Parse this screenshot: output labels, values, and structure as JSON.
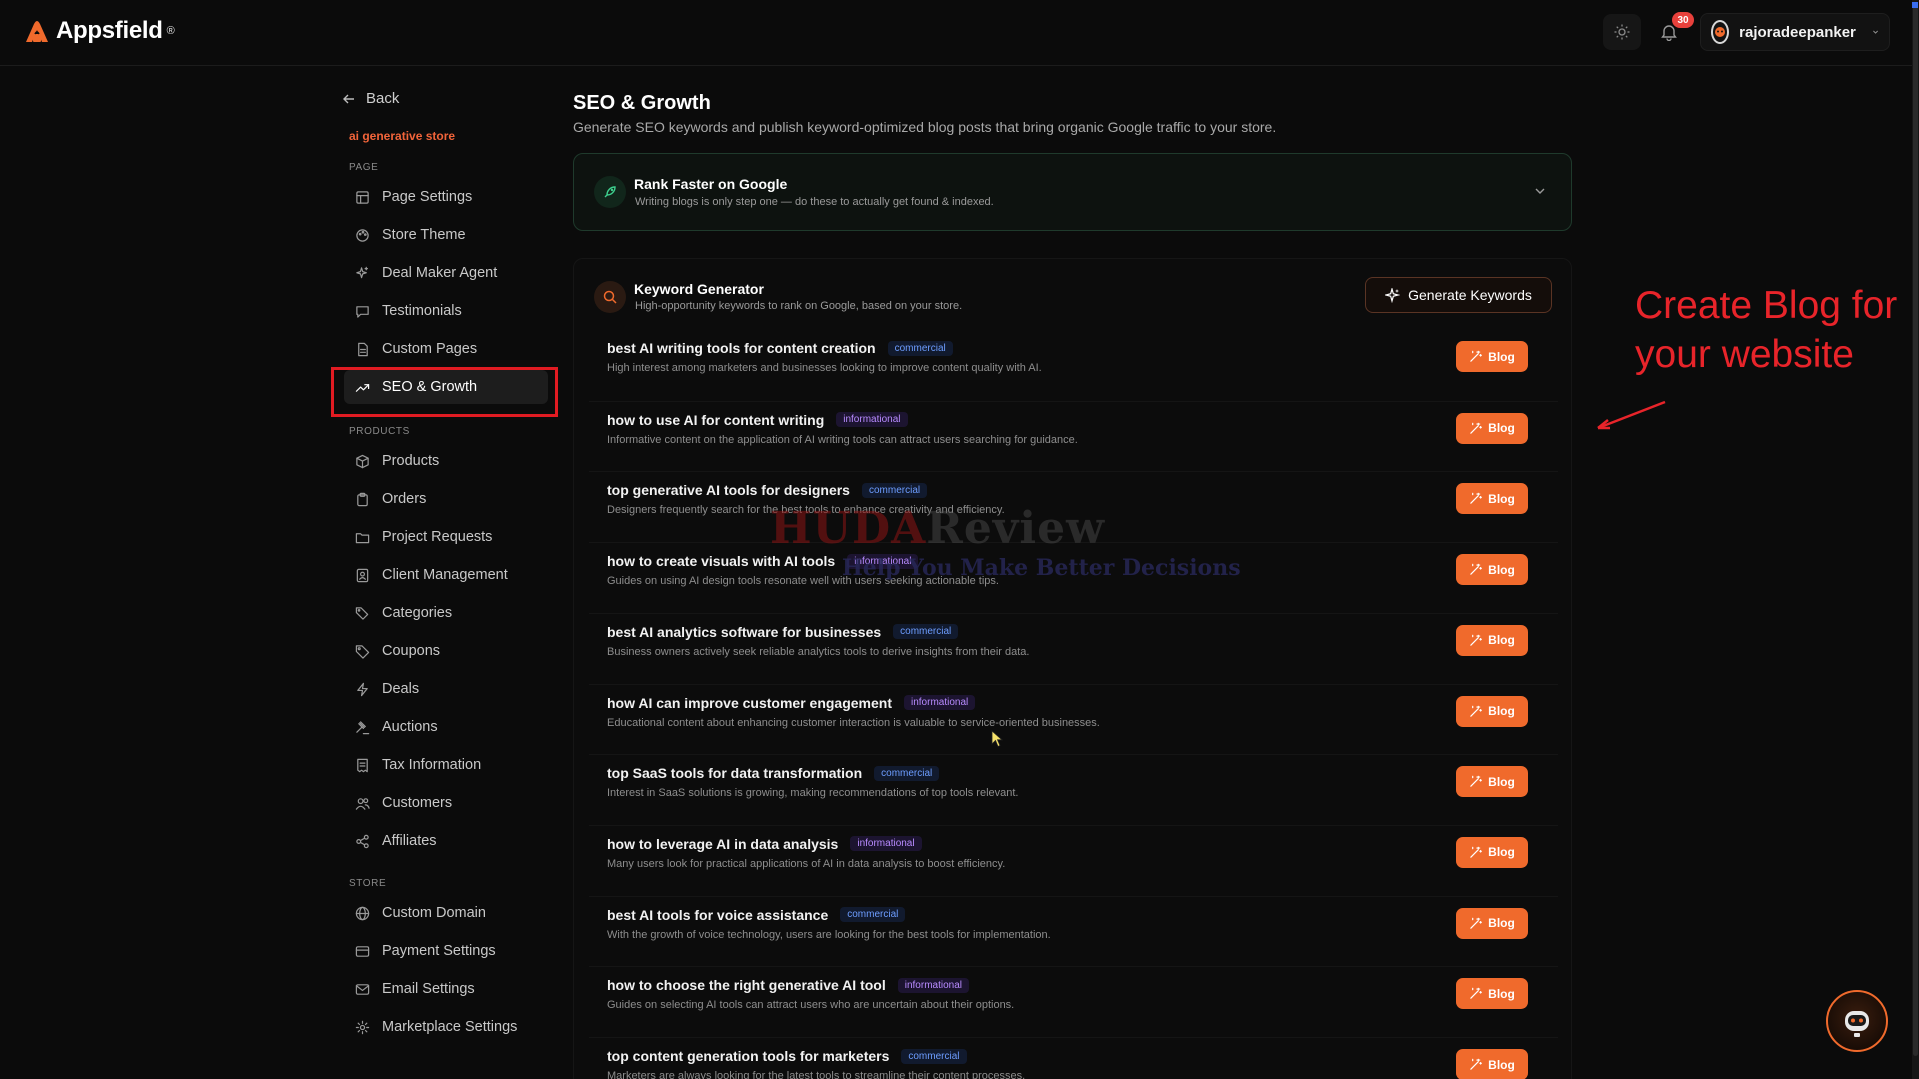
{
  "app": {
    "name": "Appsfield"
  },
  "header": {
    "notification_count": "30",
    "username": "rajoradeepanker"
  },
  "sidebar": {
    "back_label": "Back",
    "store_name": "ai generative store",
    "sections": {
      "page": "PAGE",
      "products": "PRODUCTS",
      "store": "STORE"
    },
    "page_items": [
      {
        "label": "Page Settings",
        "icon": "layout-icon"
      },
      {
        "label": "Store Theme",
        "icon": "palette-icon"
      },
      {
        "label": "Deal Maker Agent",
        "icon": "sparkle-icon"
      },
      {
        "label": "Testimonials",
        "icon": "message-icon"
      },
      {
        "label": "Custom Pages",
        "icon": "file-icon"
      },
      {
        "label": "SEO & Growth",
        "icon": "trending-up-icon",
        "active": true
      }
    ],
    "product_items": [
      {
        "label": "Products",
        "icon": "box-icon"
      },
      {
        "label": "Orders",
        "icon": "clipboard-icon"
      },
      {
        "label": "Project Requests",
        "icon": "folder-icon"
      },
      {
        "label": "Client Management",
        "icon": "contact-icon"
      },
      {
        "label": "Categories",
        "icon": "tags-icon"
      },
      {
        "label": "Coupons",
        "icon": "tag-icon"
      },
      {
        "label": "Deals",
        "icon": "zap-icon"
      },
      {
        "label": "Auctions",
        "icon": "gavel-icon"
      },
      {
        "label": "Tax Information",
        "icon": "receipt-icon"
      },
      {
        "label": "Customers",
        "icon": "users-icon"
      },
      {
        "label": "Affiliates",
        "icon": "share-icon"
      }
    ],
    "store_items": [
      {
        "label": "Custom Domain",
        "icon": "globe-icon"
      },
      {
        "label": "Payment Settings",
        "icon": "credit-card-icon"
      },
      {
        "label": "Email Settings",
        "icon": "mail-icon"
      },
      {
        "label": "Marketplace Settings",
        "icon": "gear-icon"
      }
    ]
  },
  "main": {
    "title": "SEO & Growth",
    "subtitle": "Generate SEO keywords and publish keyword-optimized blog posts that bring organic Google traffic to your store.",
    "rank_card": {
      "title": "Rank Faster on Google",
      "subtitle": "Writing blogs is only step one — do these to actually get found & indexed."
    },
    "keyword_generator": {
      "title": "Keyword Generator",
      "subtitle": "High-opportunity keywords to rank on Google, based on your store.",
      "button_label": "Generate Keywords",
      "blog_label": "Blog",
      "keywords": [
        {
          "keyword": "best AI writing tools for content creation",
          "tag": "commercial",
          "description": "High interest among marketers and businesses looking to improve content quality with AI."
        },
        {
          "keyword": "how to use AI for content writing",
          "tag": "informational",
          "description": "Informative content on the application of AI writing tools can attract users searching for guidance."
        },
        {
          "keyword": "top generative AI tools for designers",
          "tag": "commercial",
          "description": "Designers frequently search for the best tools to enhance creativity and efficiency."
        },
        {
          "keyword": "how to create visuals with AI tools",
          "tag": "informational",
          "description": "Guides on using AI design tools resonate well with users seeking actionable tips."
        },
        {
          "keyword": "best AI analytics software for businesses",
          "tag": "commercial",
          "description": "Business owners actively seek reliable analytics tools to derive insights from their data."
        },
        {
          "keyword": "how AI can improve customer engagement",
          "tag": "informational",
          "description": "Educational content about enhancing customer interaction is valuable to service-oriented businesses."
        },
        {
          "keyword": "top SaaS tools for data transformation",
          "tag": "commercial",
          "description": "Interest in SaaS solutions is growing, making recommendations of top tools relevant."
        },
        {
          "keyword": "how to leverage AI in data analysis",
          "tag": "informational",
          "description": "Many users look for practical applications of AI in data analysis to boost efficiency."
        },
        {
          "keyword": "best AI tools for voice assistance",
          "tag": "commercial",
          "description": "With the growth of voice technology, users are looking for the best tools for implementation."
        },
        {
          "keyword": "how to choose the right generative AI tool",
          "tag": "informational",
          "description": "Guides on selecting AI tools can attract users who are uncertain about their options."
        },
        {
          "keyword": "top content generation tools for marketers",
          "tag": "commercial",
          "description": "Marketers are always looking for the latest tools to streamline their content processes."
        }
      ]
    }
  },
  "annotation": {
    "text": "Create Blog for your website"
  },
  "watermark": {
    "brand_a": "HUDA",
    "brand_b": "Review",
    "tagline": "Help You Make Better Decisions"
  },
  "colors": {
    "accent": "#f06a2c",
    "highlight": "#e11b22",
    "background": "#0b0b0b"
  }
}
